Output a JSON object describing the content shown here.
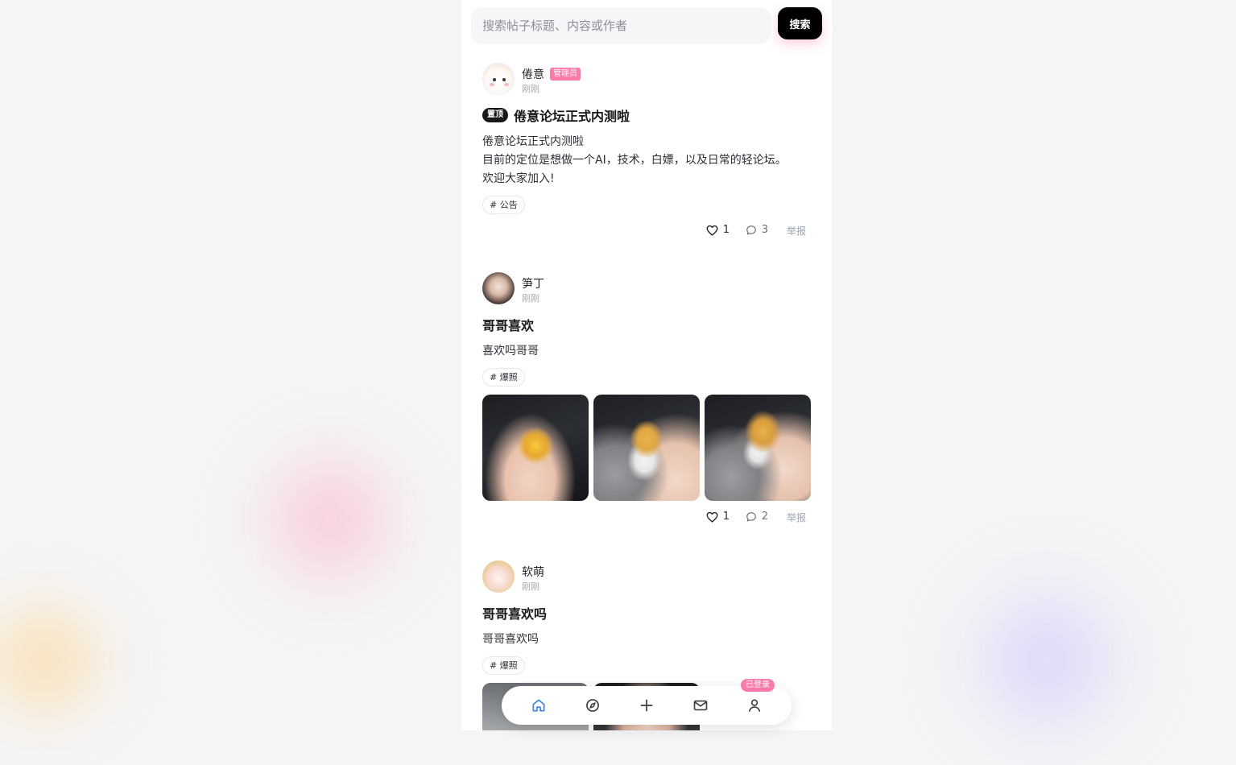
{
  "search": {
    "placeholder": "搜索帖子标题、内容或作者",
    "button_label": "搜索"
  },
  "posts": [
    {
      "author": "倦意",
      "role_badge": "管理员",
      "time": "刚刚",
      "pinned_label": "置顶",
      "title": "倦意论坛正式内测啦",
      "body_lines": [
        "倦意论坛正式内测啦",
        "目前的定位是想做一个AI，技术，白嫖，以及日常的轻论坛。",
        "欢迎大家加入!"
      ],
      "tag": "# 公告",
      "likes": "1",
      "comments": "3",
      "report_label": "举报"
    },
    {
      "author": "笋丁",
      "time": "刚刚",
      "title": "哥哥喜欢",
      "body_lines": [
        "喜欢吗哥哥"
      ],
      "tag": "# 爆照",
      "likes": "1",
      "comments": "2",
      "report_label": "举报"
    },
    {
      "author": "软萌",
      "time": "刚刚",
      "title": "哥哥喜欢吗",
      "body_lines": [
        "哥哥喜欢吗"
      ],
      "tag": "# 爆照"
    }
  ],
  "nav": {
    "items": [
      "home-icon",
      "explore-icon",
      "plus-icon",
      "mail-icon",
      "user-icon"
    ],
    "active": "home-icon",
    "login_badge": "已登录"
  },
  "colors": {
    "accent": "#ff7aa8",
    "active_nav": "#3b82f6",
    "dark": "#000000"
  }
}
